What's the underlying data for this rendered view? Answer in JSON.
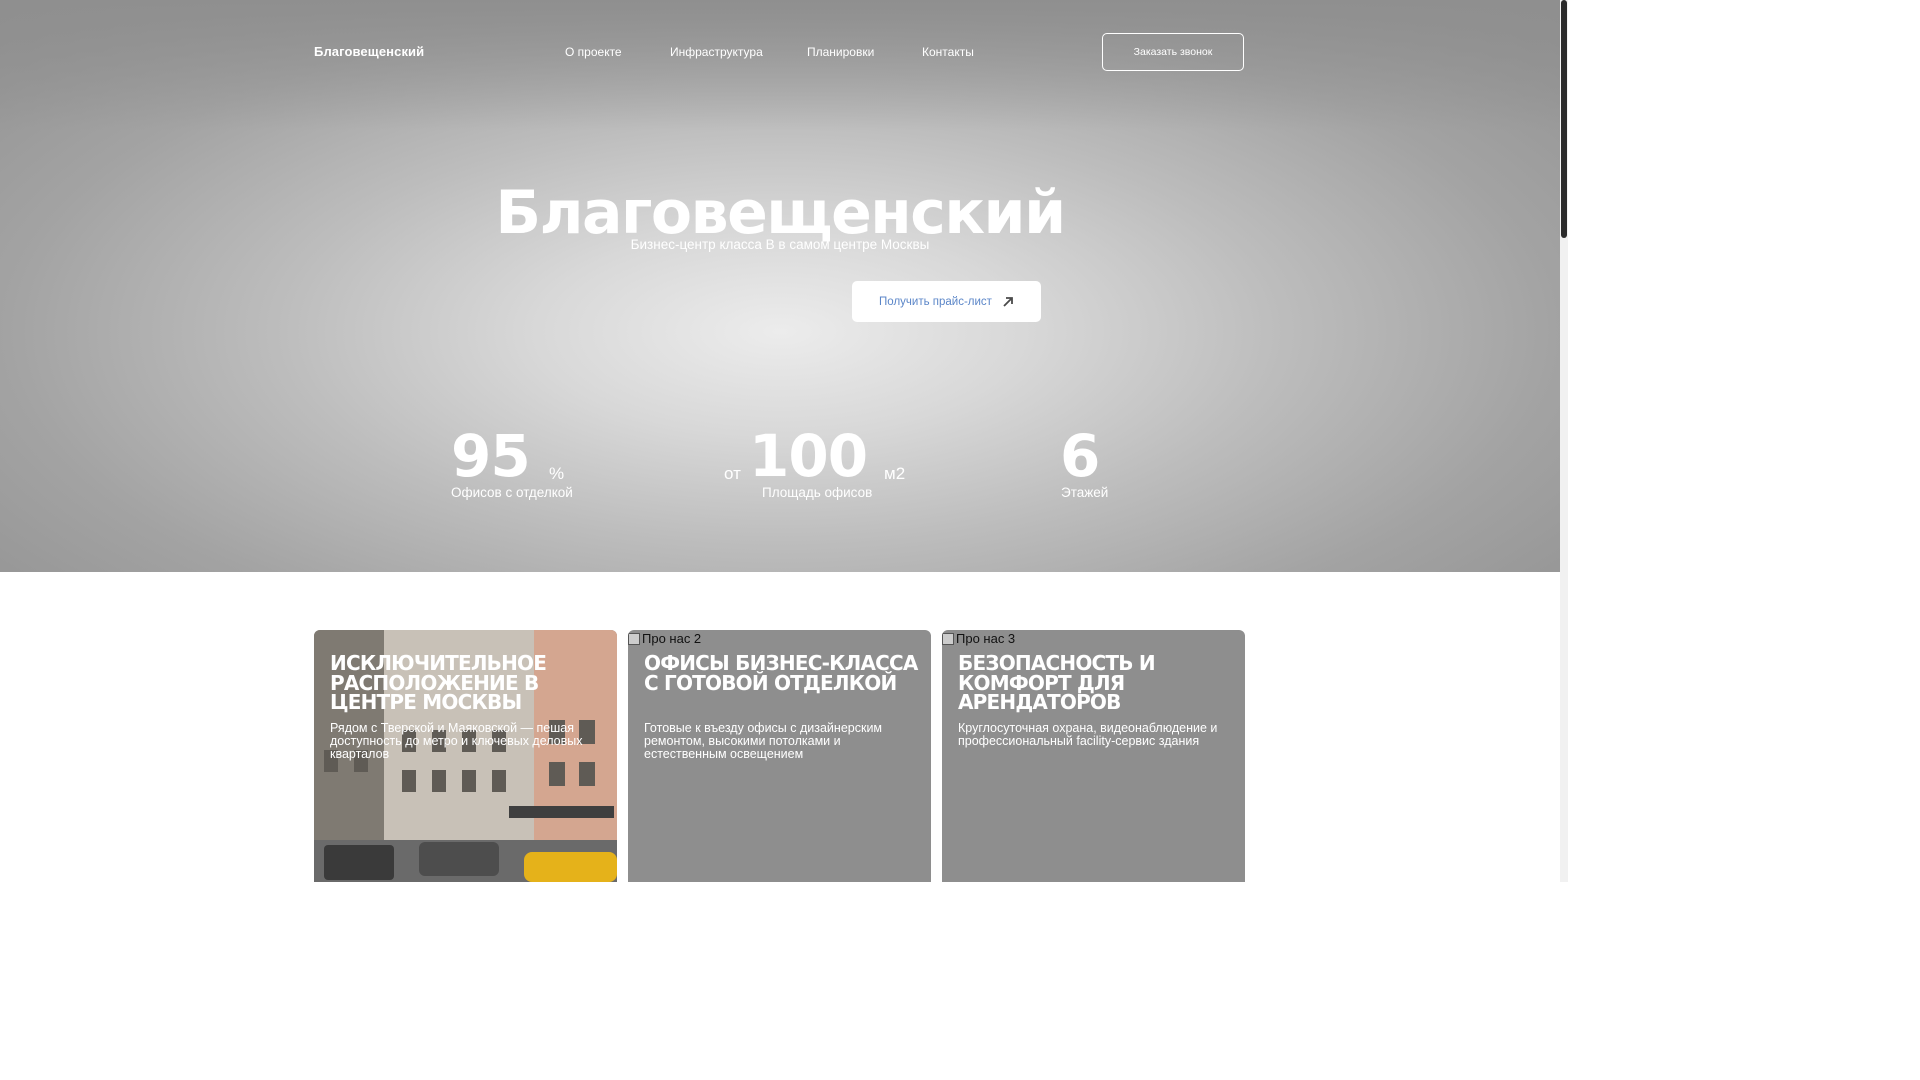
{
  "nav": {
    "logo": "Благовещенский",
    "links": [
      "О проекте",
      "Инфраструктура",
      "Планировки",
      "Контакты"
    ],
    "call_button": "Заказать звонок"
  },
  "hero": {
    "title": "Благовещенский",
    "subtitle": "Бизнес-центр класса B в самом центре Москвы",
    "price_button": "Получить прайс-лист"
  },
  "stats": [
    {
      "prefix": "",
      "value": "95",
      "unit": "%",
      "label": "Офисов с отделкой"
    },
    {
      "prefix": "от",
      "value": "100",
      "unit": "м2",
      "label": "Площадь офисов"
    },
    {
      "prefix": "",
      "value": "6",
      "unit": "",
      "label": "Этажей"
    }
  ],
  "cards": [
    {
      "alt": "",
      "title": "Исключительное расположение в центре Москвы",
      "text": "Рядом с Тверской и Маяковской — пешая доступность до метро и ключевых деловых кварталов"
    },
    {
      "alt": "Про нас 2",
      "title": "Офисы бизнес-класса с готовой отделкой",
      "text": "Готовые к въезду офисы с дизайнерским ремонтом, высокими потолками и естественным освещением"
    },
    {
      "alt": "Про нас 3",
      "title": "Безопасность и комфорт для арендаторов",
      "text": "Круглосуточная охрана, видеонаблюдение и профессиональный facility-сервис здания"
    }
  ]
}
